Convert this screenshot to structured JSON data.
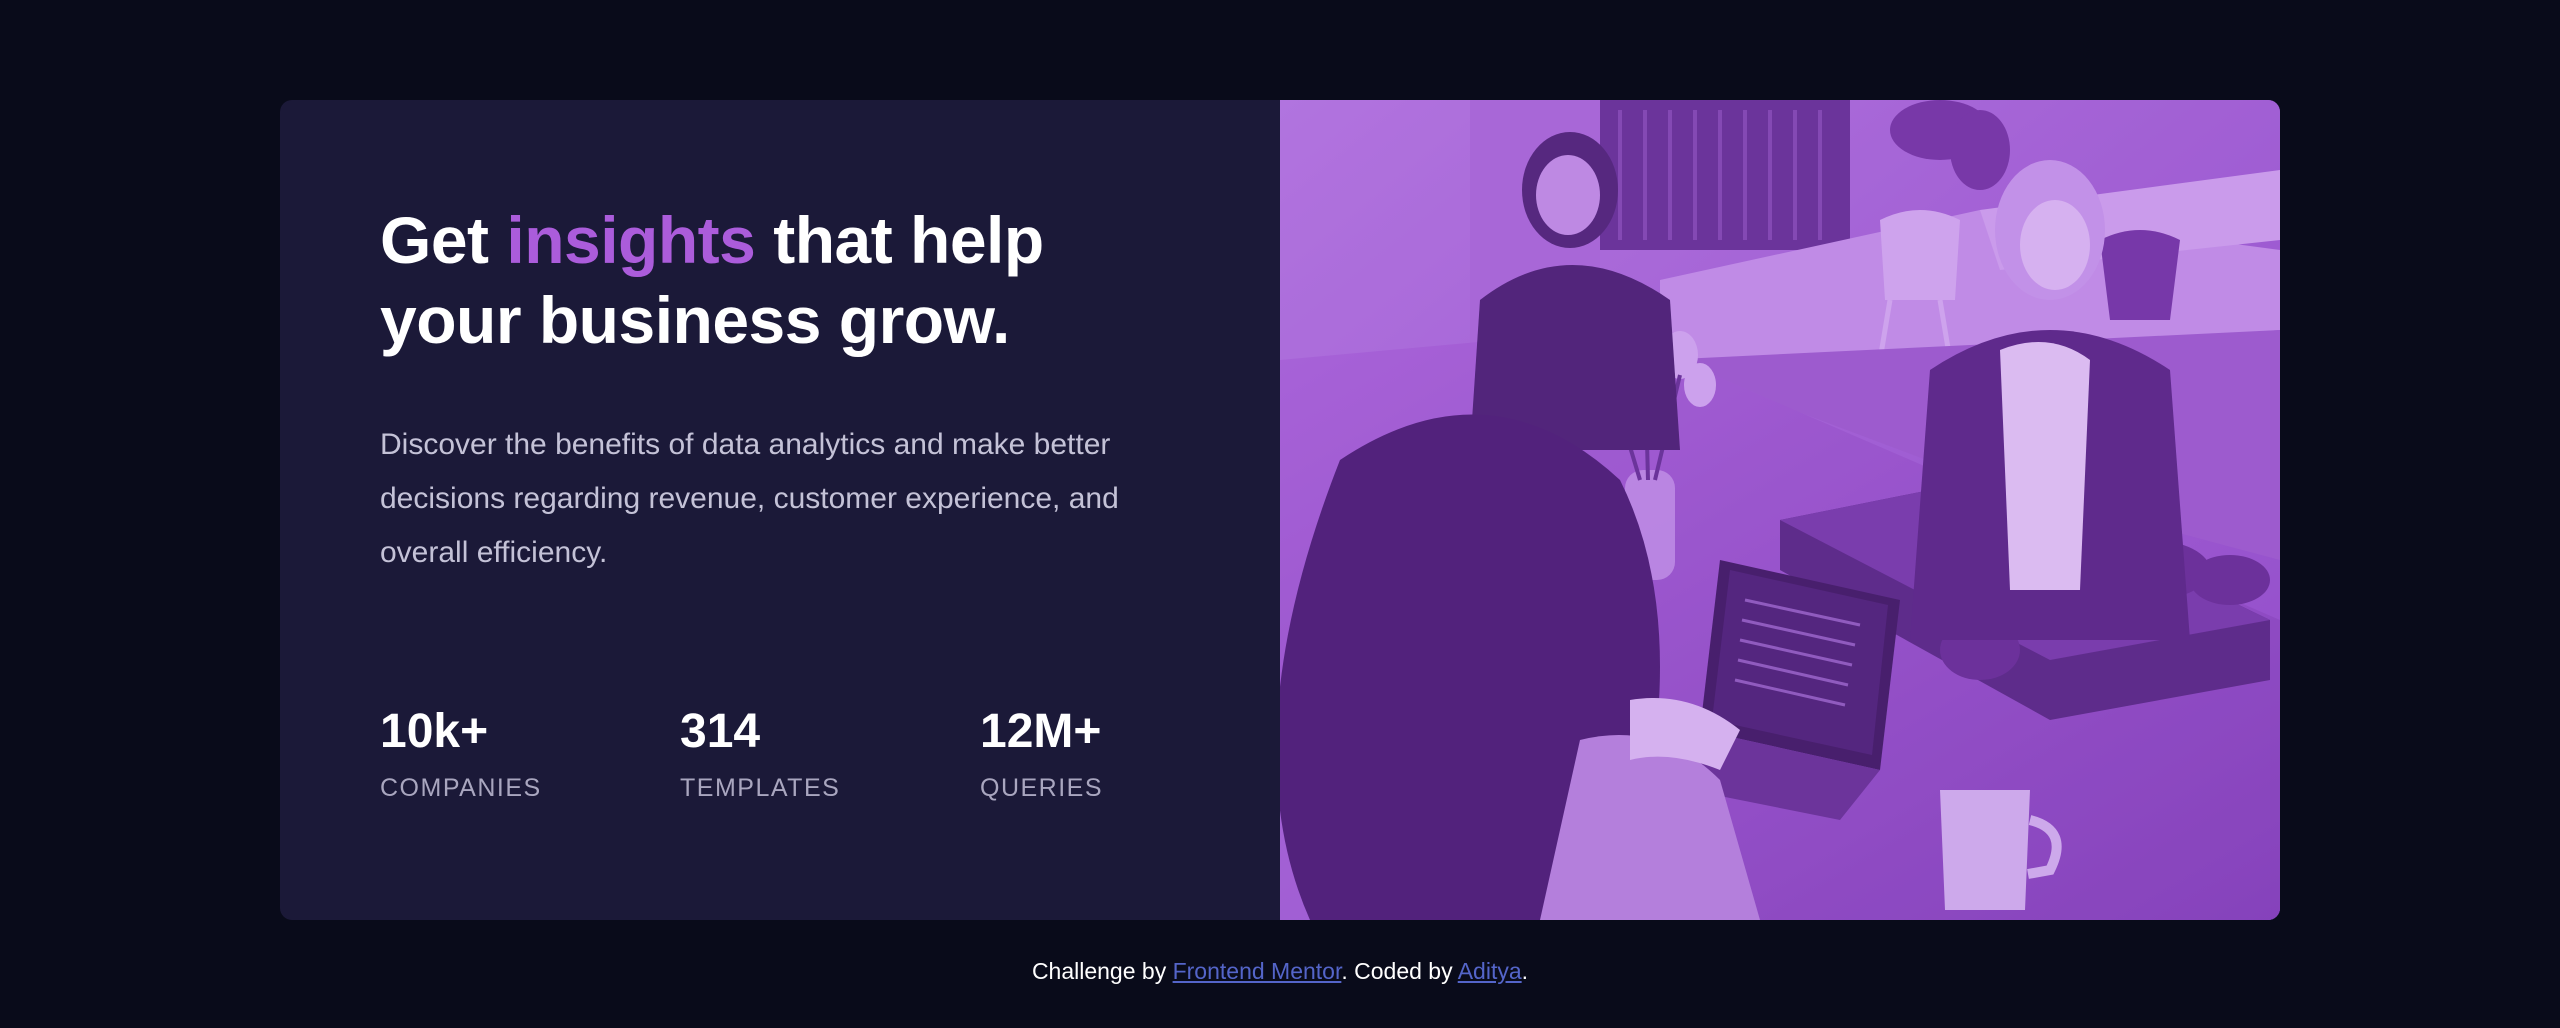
{
  "headline": {
    "part1": "Get ",
    "accent": "insights",
    "part2": " that help your business grow."
  },
  "description": "Discover the benefits of data analytics and make better decisions regarding revenue, customer experience, and overall efficiency.",
  "stats": [
    {
      "value": "10k+",
      "label": "COMPANIES"
    },
    {
      "value": "314",
      "label": "TEMPLATES"
    },
    {
      "value": "12M+",
      "label": "QUERIES"
    }
  ],
  "footer": {
    "prefix": "Challenge by ",
    "link1": "Frontend Mentor",
    "middle": ". Coded by ",
    "link2": "Aditya",
    "suffix": "."
  },
  "colors": {
    "page_background": "#090b1a",
    "card_background": "#1b1938",
    "accent": "#ab5cdb",
    "photo_tint": "#9a55d4",
    "link": "#5465c9"
  }
}
